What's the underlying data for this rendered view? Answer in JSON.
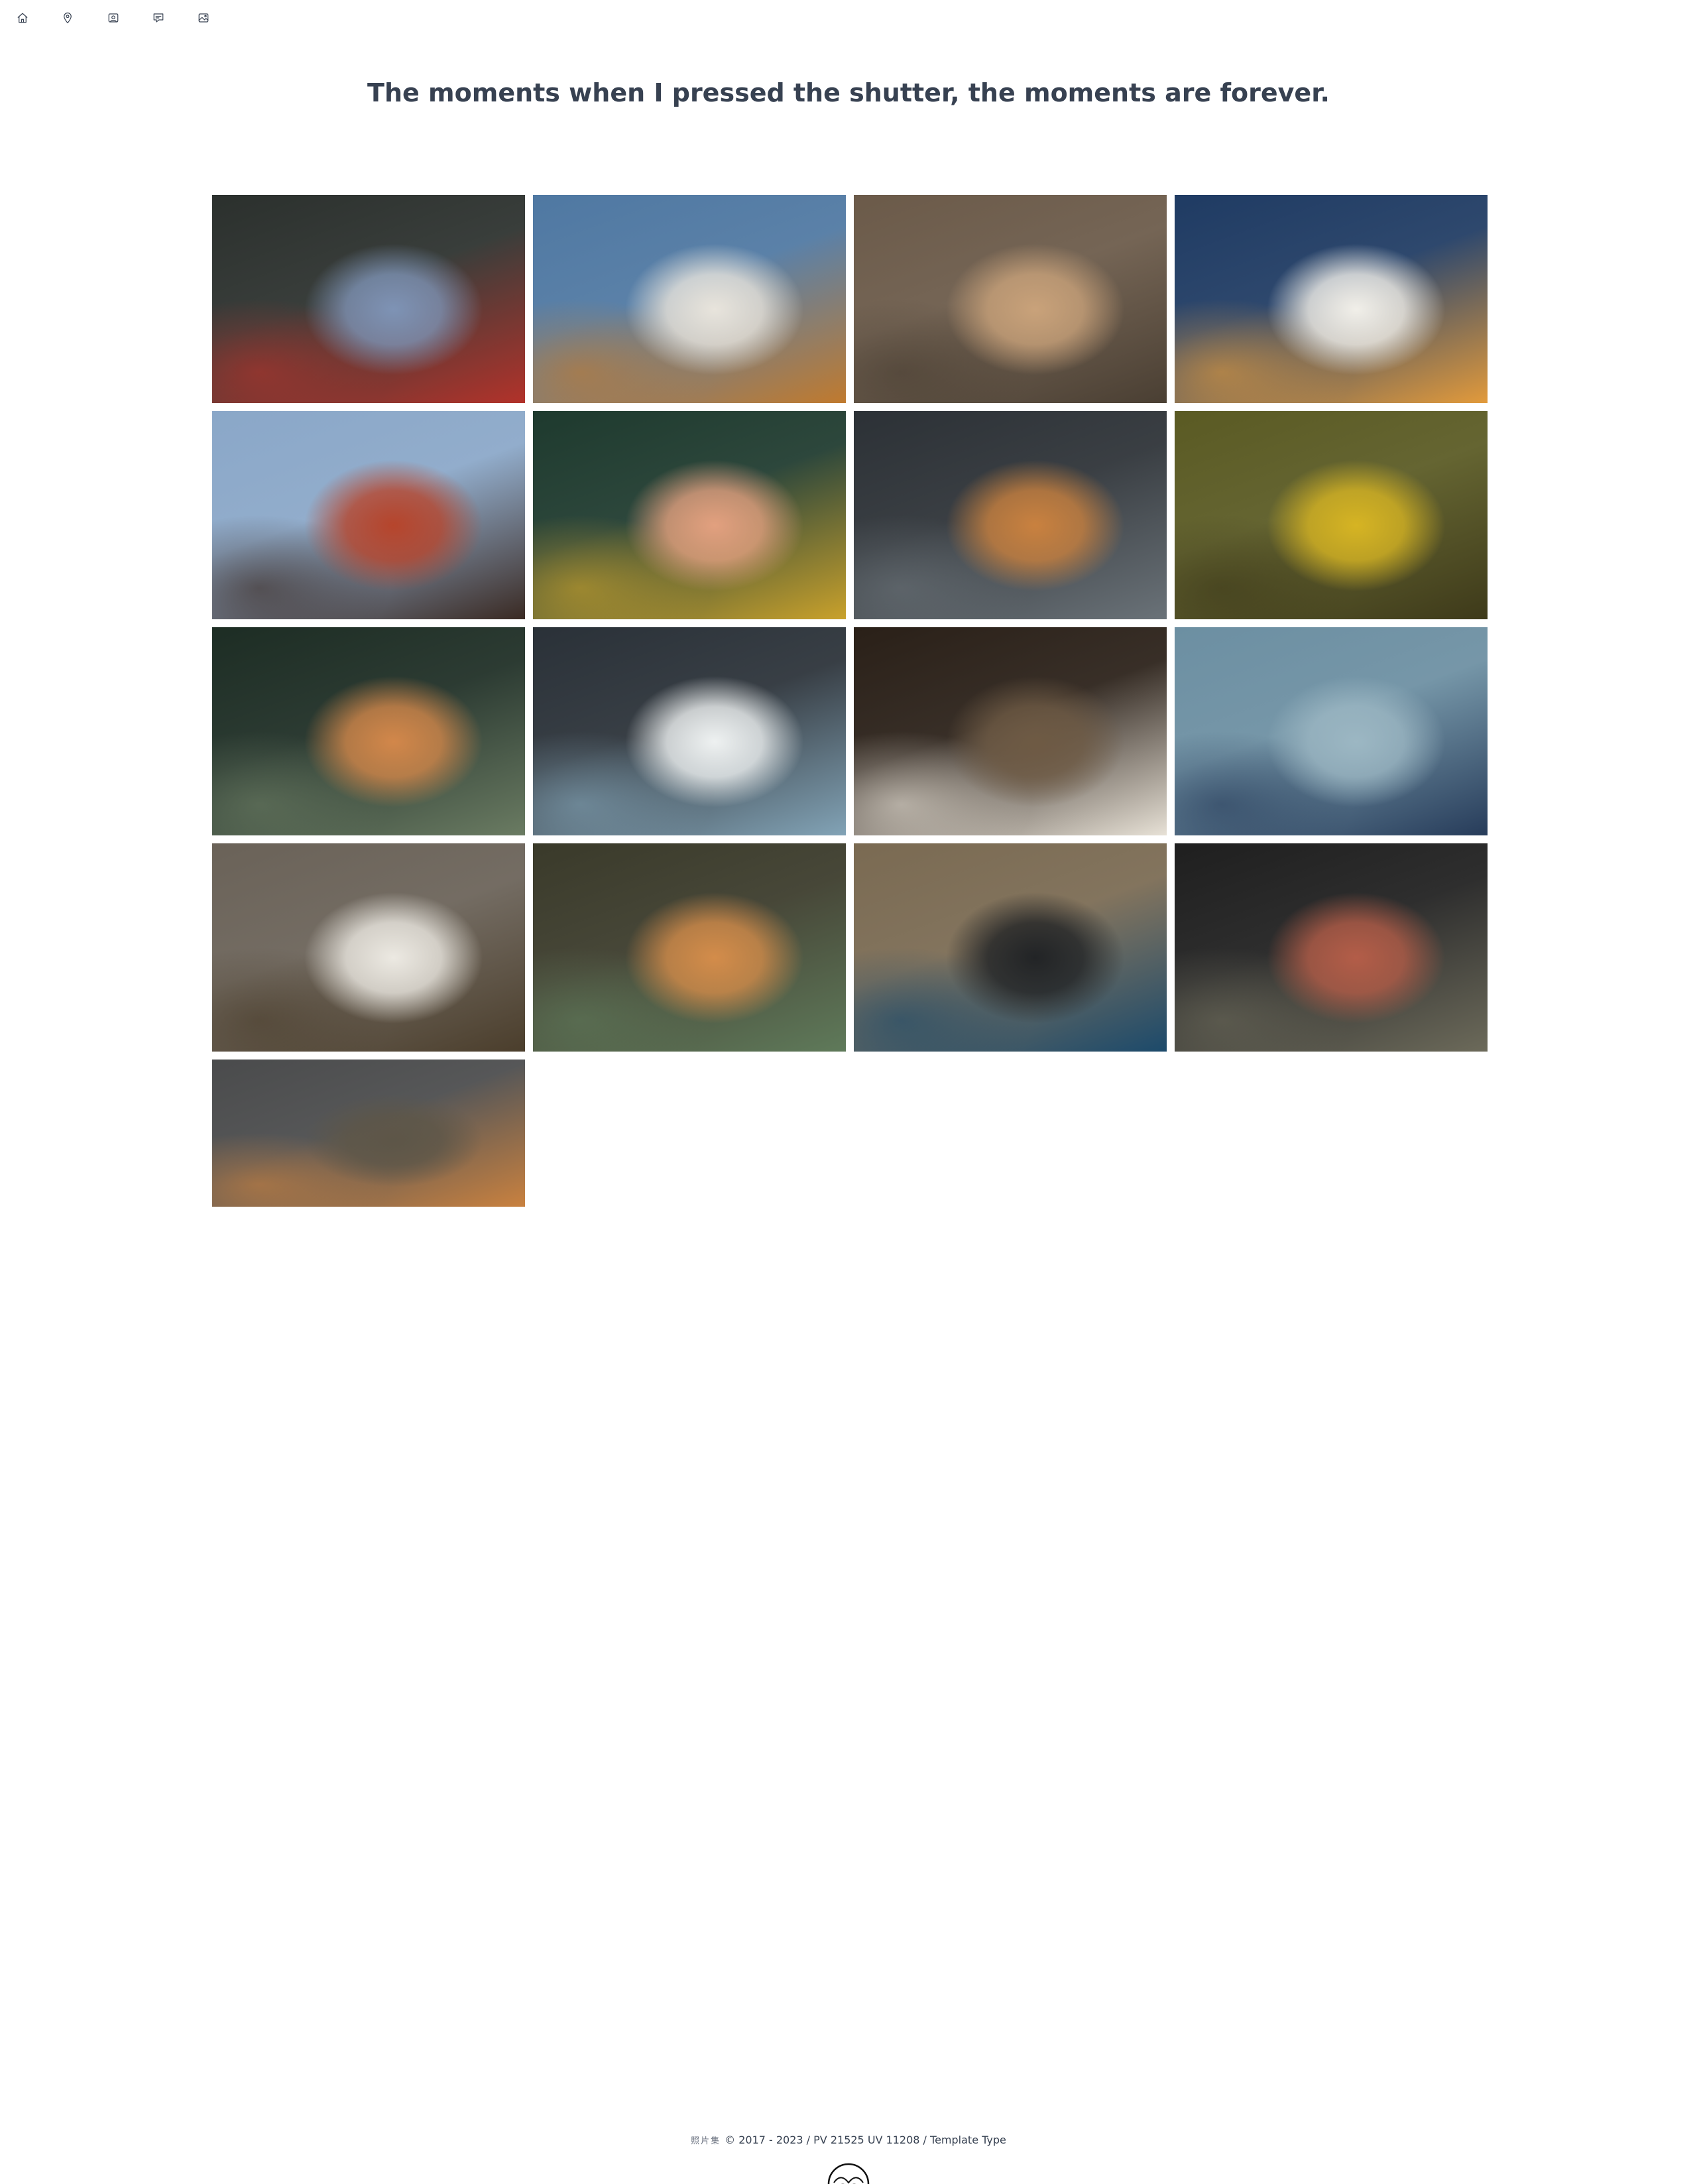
{
  "nav": {
    "items": [
      {
        "name": "home-icon",
        "label": "Home"
      },
      {
        "name": "location-pin-icon",
        "label": "Location"
      },
      {
        "name": "album-icon",
        "label": "Albums"
      },
      {
        "name": "comment-icon",
        "label": "Comments"
      },
      {
        "name": "image-icon",
        "label": "Photos"
      }
    ]
  },
  "header": {
    "title": "The moments when I pressed the shutter, the moments are forever."
  },
  "gallery": {
    "columns": 4,
    "photos": [
      {
        "subject": "national emblem on gate",
        "palette": [
          "#2b302d",
          "#7e93b5",
          "#b2322a"
        ]
      },
      {
        "subject": "white swan on water",
        "palette": [
          "#4f78a2",
          "#e8e4dc",
          "#c07a2e"
        ]
      },
      {
        "subject": "carved ornament on wall",
        "palette": [
          "#6b5a49",
          "#c9a27a",
          "#4a3f33"
        ]
      },
      {
        "subject": "white goose flapping wings",
        "palette": [
          "#1f3b63",
          "#f1efe9",
          "#e29a3b"
        ]
      },
      {
        "subject": "red palace gate",
        "palette": [
          "#8aa7c8",
          "#b6452c",
          "#3a2a23"
        ]
      },
      {
        "subject": "pink chrysanthemum",
        "palette": [
          "#1e3a2e",
          "#e2a07f",
          "#c9a12b"
        ]
      },
      {
        "subject": "orange cat on rock",
        "palette": [
          "#2c3136",
          "#c9813f",
          "#6a7278"
        ]
      },
      {
        "subject": "ginkgo forest",
        "palette": [
          "#5a5a23",
          "#d6b423",
          "#3e3a1a"
        ]
      },
      {
        "subject": "orange and white cat in garden",
        "palette": [
          "#1d2d24",
          "#d2874a",
          "#6a7b62"
        ]
      },
      {
        "subject": "coffee shop storefront",
        "palette": [
          "#2a3138",
          "#eef1f1",
          "#82a3b6"
        ]
      },
      {
        "subject": "calico cat sitting",
        "palette": [
          "#2a2018",
          "#6e5a44",
          "#e7e1d6"
        ]
      },
      {
        "subject": "railway station sign",
        "palette": [
          "#6c8fa2",
          "#9cb7c3",
          "#273c5a"
        ]
      },
      {
        "subject": "white cat on rocks",
        "palette": [
          "#6a6258",
          "#ece9e2",
          "#4b3e2c"
        ]
      },
      {
        "subject": "sleeping orange cat",
        "palette": [
          "#3a3a2a",
          "#d38c4a",
          "#5f7a5a"
        ]
      },
      {
        "subject": "bell on dusty ground",
        "palette": [
          "#7a6a52",
          "#222426",
          "#1c4a6b"
        ]
      },
      {
        "subject": "carved wooden plaque",
        "palette": [
          "#1f1f1f",
          "#b35d48",
          "#6c6a5a"
        ]
      },
      {
        "subject": "orange cat by tree trunk",
        "palette": [
          "#4a4b4c",
          "#5d5648",
          "#c9813f"
        ]
      }
    ]
  },
  "footer": {
    "chinese": "照片集",
    "text": "© 2017 - 2023 / PV 21525 UV 11208 / ",
    "template": "Template Type"
  }
}
